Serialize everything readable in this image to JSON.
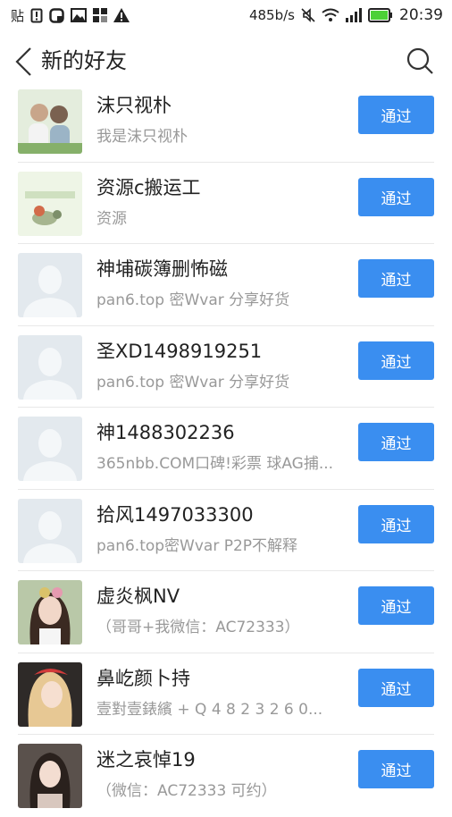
{
  "status_bar": {
    "left_chars": [
      "贴"
    ],
    "network_speed": "485b/s",
    "time": "20:39",
    "battery_color": "#4cd137"
  },
  "header": {
    "title": "新的好友",
    "back_icon": "chevron-left-icon",
    "search_icon": "search-icon"
  },
  "accent_color": "#3a8ef0",
  "requests": [
    {
      "name": "沫只视朴",
      "note": "我是沫只视朴",
      "avatar": "photo-couple",
      "button": "通过"
    },
    {
      "name": "资源c搬运工",
      "note": "资源",
      "avatar": "cartoon-green",
      "button": "通过"
    },
    {
      "name": "神埔碳簿删怖磁",
      "note": "pan6.top 密Wvar 分享好货",
      "avatar": "default",
      "button": "通过"
    },
    {
      "name": "圣XD1498919251",
      "note": "pan6.top 密Wvar 分享好货",
      "avatar": "default",
      "button": "通过"
    },
    {
      "name": "神1488302236",
      "note": "365nbb.COM口碑!彩票 球AG捕...",
      "avatar": "default",
      "button": "通过"
    },
    {
      "name": "拾风1497033300",
      "note": "pan6.top密Wvar P2P不解释",
      "avatar": "default",
      "button": "通过"
    },
    {
      "name": "虚炎枫NV",
      "note": "（哥哥+我微信：AC72333）",
      "avatar": "photo-girl-1",
      "button": "通过"
    },
    {
      "name": "鼻屹颜卜持",
      "note": "壹對壹錶繽 + Q 4 8 2 3 2 6 0...",
      "avatar": "photo-girl-2",
      "button": "通过"
    },
    {
      "name": "迷之哀悼19",
      "note": "（微信：AC72333 可约）",
      "avatar": "photo-girl-3",
      "button": "通过"
    }
  ]
}
